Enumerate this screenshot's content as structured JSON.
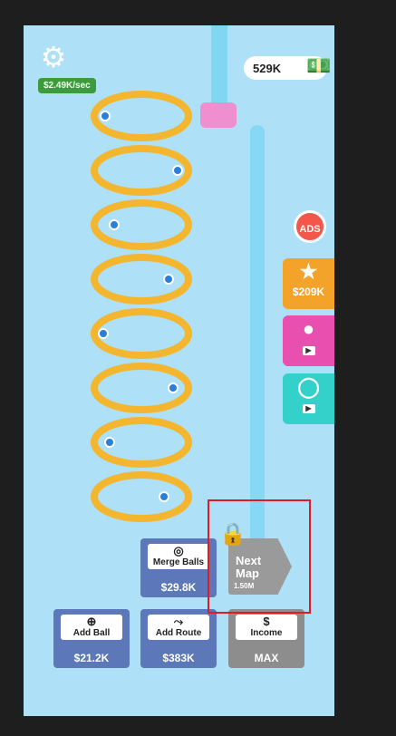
{
  "hud": {
    "income_rate": "$2.49K/sec",
    "money": "529K"
  },
  "side_buttons": {
    "ads_label": "ADS",
    "star_price": "$209K"
  },
  "buttons": {
    "merge_balls": {
      "label": "Merge Balls",
      "value": "$29.8K"
    },
    "next_map": {
      "label_line1": "Next",
      "label_line2": "Map",
      "value": "1.50M"
    },
    "add_ball": {
      "label": "Add Ball",
      "value": "$21.2K"
    },
    "add_route": {
      "label": "Add Route",
      "value": "$383K"
    },
    "income": {
      "label": "Income",
      "value": "MAX"
    }
  },
  "colors": {
    "background": "#aee0f7",
    "button_blue": "#5d78b8",
    "button_gray": "#8d8d8d",
    "highlight": "#e21b23"
  }
}
